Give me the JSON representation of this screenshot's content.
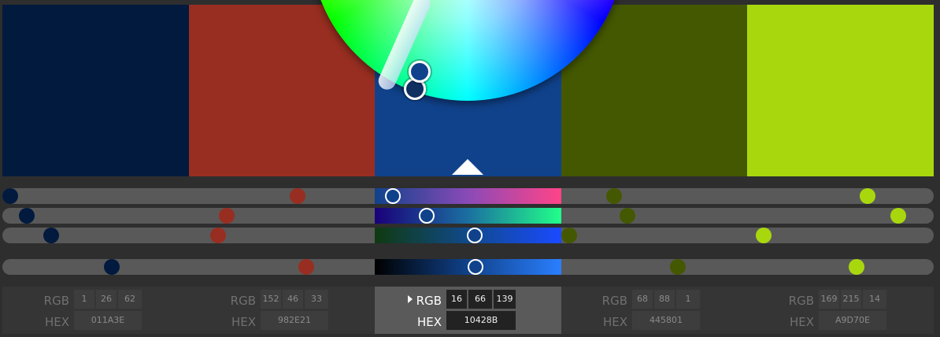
{
  "swatches": [
    {
      "color": "#011A3E",
      "rgb": [
        "1",
        "26",
        "62"
      ],
      "hex": "011A3E"
    },
    {
      "color": "#982E21",
      "rgb": [
        "152",
        "46",
        "33"
      ],
      "hex": "982E21"
    },
    {
      "color": "#10428B",
      "rgb": [
        "16",
        "66",
        "139"
      ],
      "hex": "10428B"
    },
    {
      "color": "#445801",
      "rgb": [
        "68",
        "88",
        "1"
      ],
      "hex": "445801"
    },
    {
      "color": "#A9D70E",
      "rgb": [
        "169",
        "215",
        "14"
      ],
      "hex": "A9D70E"
    }
  ],
  "selected_index": 2,
  "labels": {
    "rgb": "RGB",
    "hex": "HEX"
  },
  "icons": {
    "selected_marker": "caret-right-icon",
    "pointer": "triangle-up-icon"
  }
}
